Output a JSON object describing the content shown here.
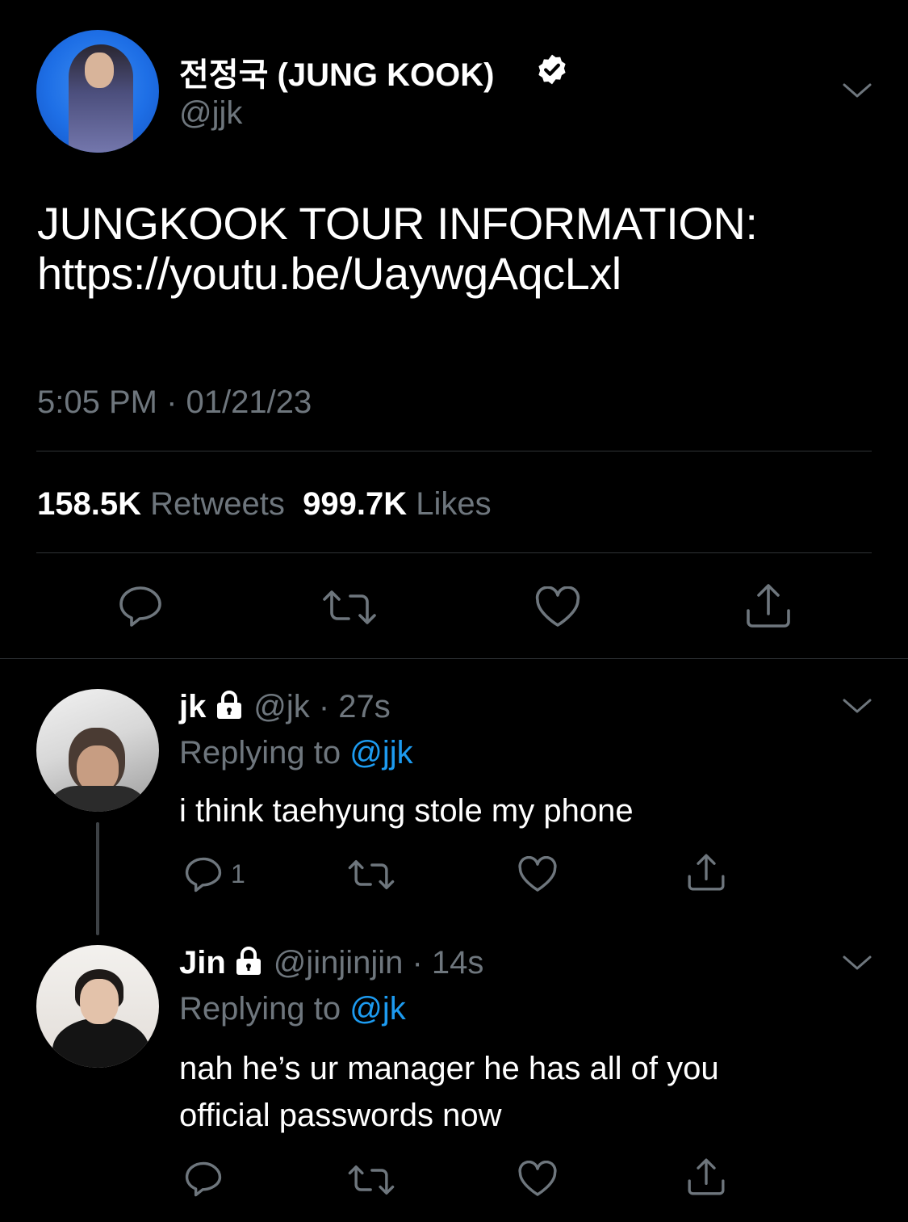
{
  "tweet": {
    "author_name": "전정국 (JUNG KOOK)",
    "author_handle": "@jjk",
    "text_line1": "JUNGKOOK TOUR INFORMATION:",
    "text_line2": "https://youtu.be/UaywgAqcLxl",
    "timestamp": "5:05 PM · 01/21/23",
    "retweets_count": "158.5K",
    "retweets_label": "Retweets",
    "likes_count": "999.7K",
    "likes_label": "Likes"
  },
  "replies": [
    {
      "name": "jk",
      "handle_time": "@jk · 27s",
      "replying_prefix": "Replying to",
      "replying_to": "@jjk",
      "text": "i think taehyung stole my phone",
      "reply_count": "1"
    },
    {
      "name": "Jin",
      "handle_time": "@jinjinjin · 14s",
      "replying_prefix": "Replying to",
      "replying_to": "@jk",
      "text_line1": "nah he’s ur manager he has all of you",
      "text_line2": "official passwords now"
    }
  ],
  "colors": {
    "background": "#000000",
    "secondary_text": "#6e767d",
    "mention": "#1d9bf0",
    "divider": "#2f3336"
  },
  "icons": [
    "verified-badge-icon",
    "chevron-down-icon",
    "reply-icon",
    "retweet-icon",
    "like-icon",
    "share-icon",
    "lock-icon"
  ]
}
